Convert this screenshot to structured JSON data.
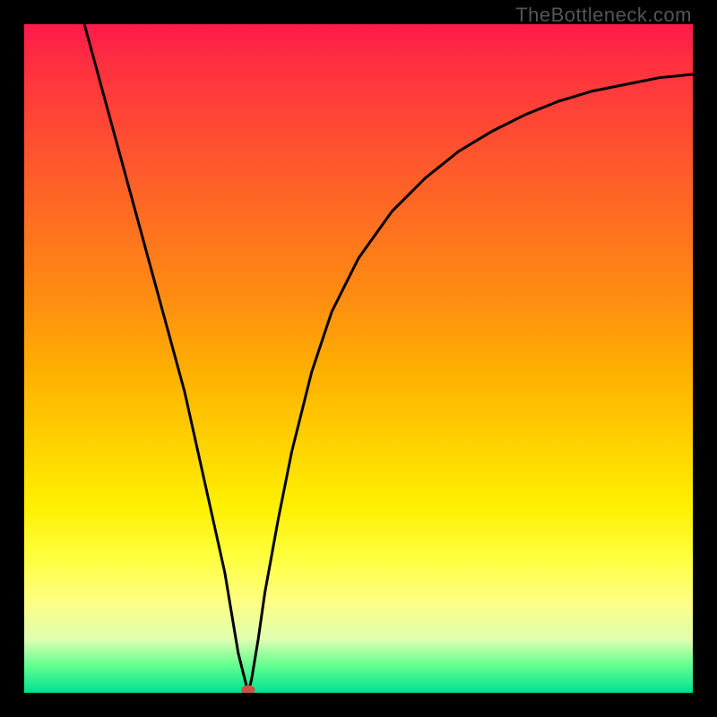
{
  "watermark": "TheBottleneck.com",
  "chart_data": {
    "type": "line",
    "title": "",
    "xlabel": "",
    "ylabel": "",
    "xlim": [
      0,
      100
    ],
    "ylim": [
      0,
      100
    ],
    "series": [
      {
        "name": "bottleneck-curve",
        "x": [
          9,
          12,
          15,
          18,
          21,
          24,
          26,
          28,
          30,
          31,
          32,
          33,
          33.5,
          34,
          35,
          36,
          38,
          40,
          43,
          46,
          50,
          55,
          60,
          65,
          70,
          75,
          80,
          85,
          90,
          95,
          100
        ],
        "values": [
          100,
          89,
          78,
          67,
          56,
          45,
          36,
          27,
          18,
          12,
          6,
          2,
          0,
          2,
          8,
          15,
          26,
          36,
          48,
          57,
          65,
          72,
          77,
          81,
          84,
          86.5,
          88.5,
          90,
          91,
          92,
          92.5
        ]
      }
    ],
    "marker": {
      "x": 33.5,
      "y": 0,
      "color": "#d05040"
    },
    "gradient_stops": [
      {
        "pos": 0,
        "color": "#ff1a4a"
      },
      {
        "pos": 50,
        "color": "#ffb000"
      },
      {
        "pos": 80,
        "color": "#ffff40"
      },
      {
        "pos": 100,
        "color": "#00e090"
      }
    ]
  }
}
